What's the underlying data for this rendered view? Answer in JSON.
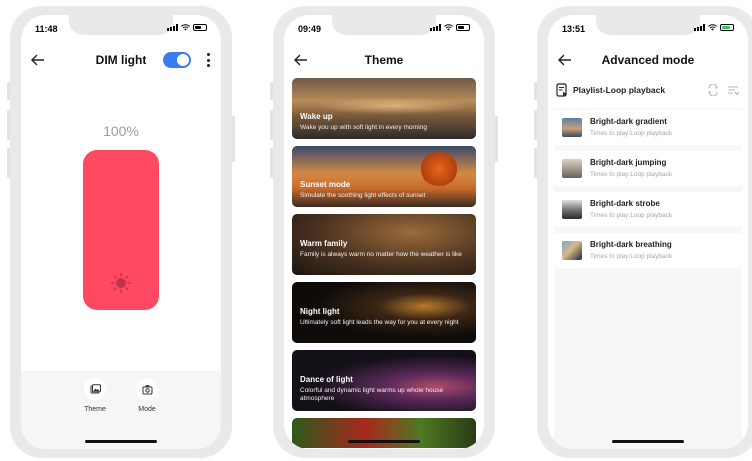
{
  "status_bars": [
    {
      "time": "11:48",
      "battery_color": "#000000"
    },
    {
      "time": "09:49",
      "battery_color": "#000000"
    },
    {
      "time": "13:51",
      "battery_color": "#34c759"
    }
  ],
  "dim_screen": {
    "title": "DIM light",
    "toggle_on": true,
    "accent_color": "#3a7bf0",
    "brightness_label": "100%",
    "brightness_level": 1.0,
    "bar_color": "#ff4963",
    "bottom_buttons": [
      {
        "label": "Theme",
        "icon": "theme-image-icon"
      },
      {
        "label": "Mode",
        "icon": "mode-camera-icon"
      }
    ]
  },
  "theme_screen": {
    "title": "Theme",
    "themes": [
      {
        "title": "Wake up",
        "subtitle": "Wake you up with soft light in every morning"
      },
      {
        "title": "Sunset mode",
        "subtitle": "Simulate the soothing light effects of sunset"
      },
      {
        "title": "Warm family",
        "subtitle": "Family is always warm no matter how the weather is like"
      },
      {
        "title": "Night light",
        "subtitle": "Ultimately soft light leads the way for you at every night"
      },
      {
        "title": "Dance of light",
        "subtitle": "Colorful and dynamic light warms up whole house atmosphere"
      }
    ]
  },
  "advanced_screen": {
    "title": "Advanced mode",
    "playlist_label": "Playlist-Loop playback",
    "modes": [
      {
        "title": "Bright-dark gradient",
        "subtitle": "Times to play:Loop playback"
      },
      {
        "title": "Bright-dark jumping",
        "subtitle": "Times to play:Loop playback"
      },
      {
        "title": "Bright-dark strobe",
        "subtitle": "Times to play:Loop playback"
      },
      {
        "title": "Bright-dark breathing",
        "subtitle": "Times to play:Loop playback"
      }
    ]
  }
}
